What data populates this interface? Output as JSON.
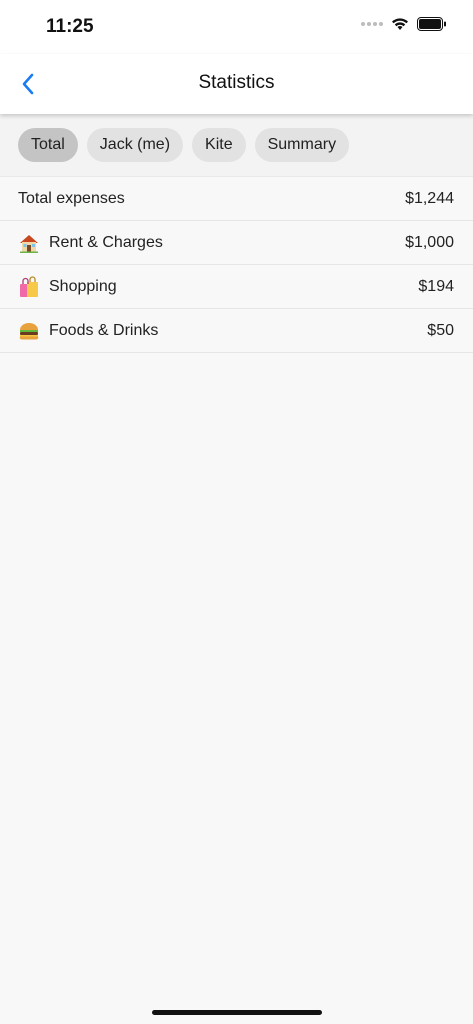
{
  "status_bar": {
    "time": "11:25"
  },
  "nav": {
    "title": "Statistics",
    "back_icon": "chevron-left-icon",
    "accent": "#1a7cf5"
  },
  "tabs": [
    {
      "label": "Total",
      "active": true
    },
    {
      "label": "Jack (me)",
      "active": false
    },
    {
      "label": "Kite",
      "active": false
    },
    {
      "label": "Summary",
      "active": false
    }
  ],
  "expenses": {
    "total_label": "Total expenses",
    "total_value": "$1,244",
    "items": [
      {
        "icon": "house-emoji-icon",
        "label": "Rent & Charges",
        "value": "$1,000"
      },
      {
        "icon": "shopping-bags-emoji-icon",
        "label": "Shopping",
        "value": "$194"
      },
      {
        "icon": "hamburger-emoji-icon",
        "label": "Foods & Drinks",
        "value": "$50"
      }
    ]
  }
}
